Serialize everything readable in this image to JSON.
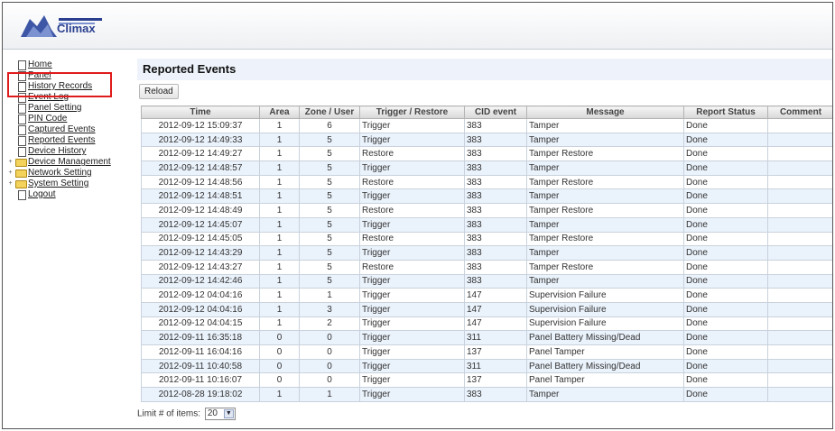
{
  "header": {
    "logo_text": "Climax"
  },
  "sidebar": {
    "items": [
      {
        "label": "Home",
        "icon": "file-icon",
        "expandable": false
      },
      {
        "label": "Panel",
        "icon": "file-icon",
        "expandable": false
      },
      {
        "label": "History Records",
        "icon": "file-icon",
        "expandable": false
      },
      {
        "label": "Event Log",
        "icon": "file-icon",
        "expandable": false
      },
      {
        "label": "Panel Setting",
        "icon": "file-icon",
        "expandable": false
      },
      {
        "label": "PIN Code",
        "icon": "file-icon",
        "expandable": false
      },
      {
        "label": "Captured Events",
        "icon": "file-icon",
        "expandable": false
      },
      {
        "label": "Reported Events",
        "icon": "file-icon",
        "expandable": false
      },
      {
        "label": "Device History",
        "icon": "file-icon",
        "expandable": false
      },
      {
        "label": "Device Management",
        "icon": "folder-icon",
        "expandable": true
      },
      {
        "label": "Network Setting",
        "icon": "folder-icon",
        "expandable": true
      },
      {
        "label": "System Setting",
        "icon": "folder-icon",
        "expandable": true
      },
      {
        "label": "Logout",
        "icon": "file-icon",
        "expandable": false
      }
    ],
    "highlight_color": "#e01b1b"
  },
  "main": {
    "title": "Reported Events",
    "reload_label": "Reload",
    "limit_label": "Limit # of items:",
    "limit_value": "20"
  },
  "table": {
    "columns": [
      "Time",
      "Area",
      "Zone / User",
      "Trigger / Restore",
      "CID event",
      "Message",
      "Report Status",
      "Comment"
    ],
    "rows": [
      [
        "2012-09-12 15:09:37",
        "1",
        "6",
        "Trigger",
        "383",
        "Tamper",
        "Done",
        ""
      ],
      [
        "2012-09-12 14:49:33",
        "1",
        "5",
        "Trigger",
        "383",
        "Tamper",
        "Done",
        ""
      ],
      [
        "2012-09-12 14:49:27",
        "1",
        "5",
        "Restore",
        "383",
        "Tamper Restore",
        "Done",
        ""
      ],
      [
        "2012-09-12 14:48:57",
        "1",
        "5",
        "Trigger",
        "383",
        "Tamper",
        "Done",
        ""
      ],
      [
        "2012-09-12 14:48:56",
        "1",
        "5",
        "Restore",
        "383",
        "Tamper Restore",
        "Done",
        ""
      ],
      [
        "2012-09-12 14:48:51",
        "1",
        "5",
        "Trigger",
        "383",
        "Tamper",
        "Done",
        ""
      ],
      [
        "2012-09-12 14:48:49",
        "1",
        "5",
        "Restore",
        "383",
        "Tamper Restore",
        "Done",
        ""
      ],
      [
        "2012-09-12 14:45:07",
        "1",
        "5",
        "Trigger",
        "383",
        "Tamper",
        "Done",
        ""
      ],
      [
        "2012-09-12 14:45:05",
        "1",
        "5",
        "Restore",
        "383",
        "Tamper Restore",
        "Done",
        ""
      ],
      [
        "2012-09-12 14:43:29",
        "1",
        "5",
        "Trigger",
        "383",
        "Tamper",
        "Done",
        ""
      ],
      [
        "2012-09-12 14:43:27",
        "1",
        "5",
        "Restore",
        "383",
        "Tamper Restore",
        "Done",
        ""
      ],
      [
        "2012-09-12 14:42:46",
        "1",
        "5",
        "Trigger",
        "383",
        "Tamper",
        "Done",
        ""
      ],
      [
        "2012-09-12 04:04:16",
        "1",
        "1",
        "Trigger",
        "147",
        "Supervision Failure",
        "Done",
        ""
      ],
      [
        "2012-09-12 04:04:16",
        "1",
        "3",
        "Trigger",
        "147",
        "Supervision Failure",
        "Done",
        ""
      ],
      [
        "2012-09-12 04:04:15",
        "1",
        "2",
        "Trigger",
        "147",
        "Supervision Failure",
        "Done",
        ""
      ],
      [
        "2012-09-11 16:35:18",
        "0",
        "0",
        "Trigger",
        "311",
        "Panel Battery Missing/Dead",
        "Done",
        ""
      ],
      [
        "2012-09-11 16:04:16",
        "0",
        "0",
        "Trigger",
        "137",
        "Panel Tamper",
        "Done",
        ""
      ],
      [
        "2012-09-11 10:40:58",
        "0",
        "0",
        "Trigger",
        "311",
        "Panel Battery Missing/Dead",
        "Done",
        ""
      ],
      [
        "2012-09-11 10:16:07",
        "0",
        "0",
        "Trigger",
        "137",
        "Panel Tamper",
        "Done",
        ""
      ],
      [
        "2012-08-28 19:18:02",
        "1",
        "1",
        "Trigger",
        "383",
        "Tamper",
        "Done",
        ""
      ]
    ]
  }
}
